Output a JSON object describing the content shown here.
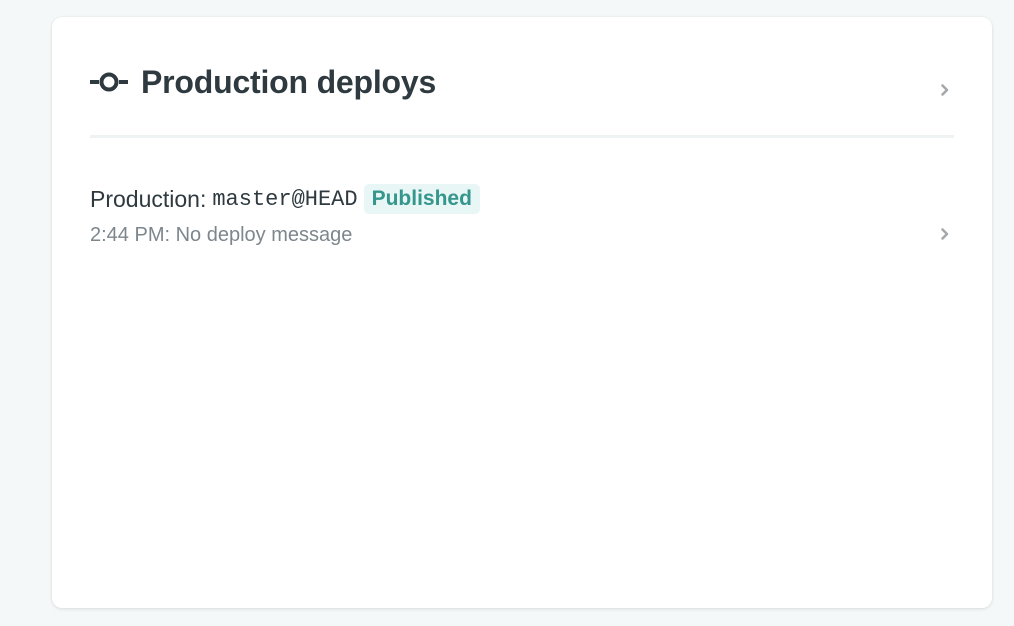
{
  "card": {
    "title": "Production deploys",
    "title_icon": "commit-icon",
    "chevron_icon": "chevron-right-icon"
  },
  "deploys": [
    {
      "label": "Production:",
      "ref": "master@HEAD",
      "status": "Published",
      "time": "2:44 PM:",
      "message": "No deploy message",
      "chevron_icon": "chevron-right-icon"
    }
  ],
  "colors": {
    "background": "#f5f8f8",
    "card": "#ffffff",
    "title_text": "#2e3a3f",
    "muted_text": "#7d868c",
    "badge_text": "#34968c",
    "badge_bg": "#e8f6f5",
    "divider": "#eff2f3",
    "chevron": "#a3a9ac"
  }
}
